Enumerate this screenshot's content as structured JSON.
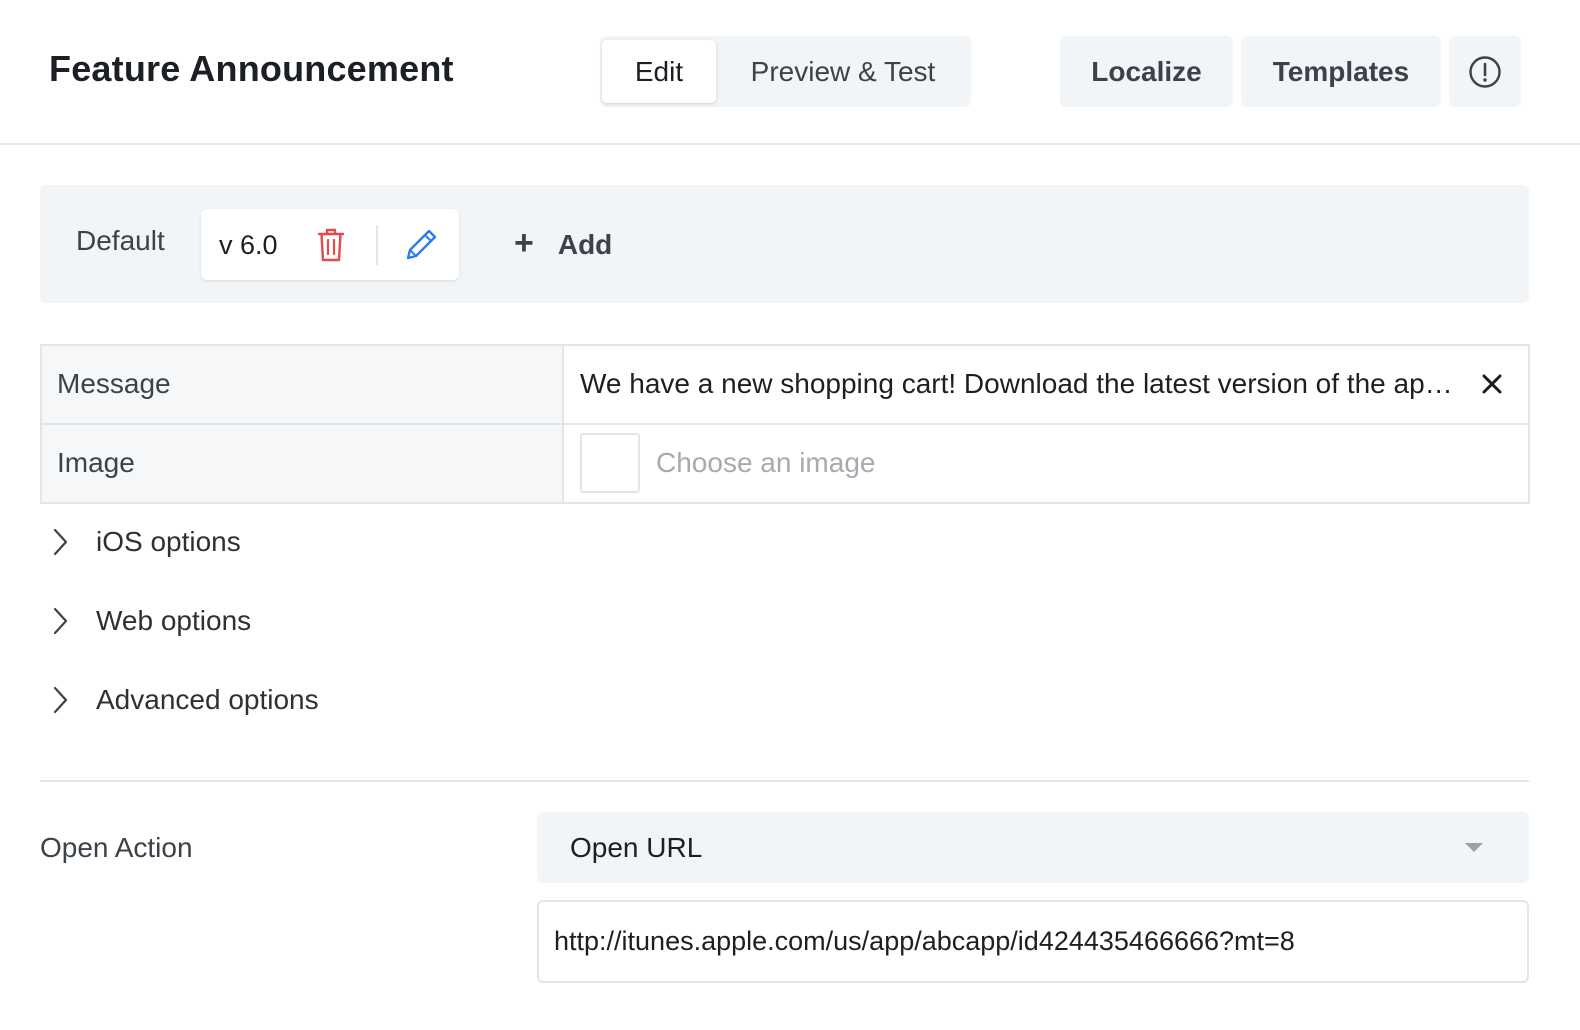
{
  "header": {
    "title": "Feature Announcement",
    "tabs": [
      {
        "label": "Edit",
        "active": true
      },
      {
        "label": "Preview & Test",
        "active": false
      }
    ],
    "buttons": {
      "localize": "Localize",
      "templates": "Templates",
      "info_icon": "info-circle-icon"
    }
  },
  "variants": {
    "default_label": "Default",
    "selected": {
      "name": "v 6.0",
      "delete_icon": "trash-icon",
      "edit_icon": "pencil-icon"
    },
    "add_label": "Add"
  },
  "fields": {
    "message": {
      "label": "Message",
      "value": "We have a new shopping cart! Download the latest version of the app today.",
      "clear_icon": "close-icon"
    },
    "image": {
      "label": "Image",
      "placeholder": "Choose an image"
    }
  },
  "sections": [
    {
      "label": "iOS options",
      "expanded": false
    },
    {
      "label": "Web options",
      "expanded": false
    },
    {
      "label": "Advanced options",
      "expanded": false
    }
  ],
  "open_action": {
    "label": "Open Action",
    "selected": "Open URL",
    "url": "http://itunes.apple.com/us/app/abcapp/id424435466666?mt=8"
  },
  "colors": {
    "delete_accent": "#e5484d",
    "edit_accent": "#2b7de9",
    "panel_bg": "#f2f5f8",
    "border": "#e3e6e9"
  }
}
